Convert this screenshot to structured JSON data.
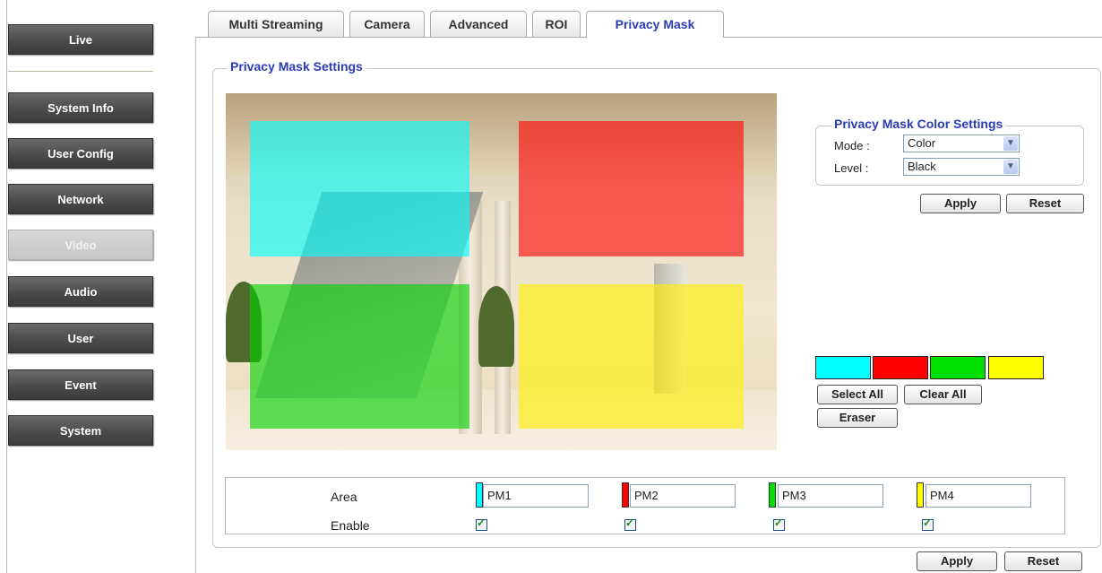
{
  "sidebar": {
    "items": [
      {
        "label": "Live"
      },
      {
        "label": "System Info"
      },
      {
        "label": "User Config"
      },
      {
        "label": "Network"
      },
      {
        "label": "Video",
        "active": true
      },
      {
        "label": "Audio"
      },
      {
        "label": "User"
      },
      {
        "label": "Event"
      },
      {
        "label": "System"
      }
    ]
  },
  "tabs": [
    {
      "label": "Multi Streaming"
    },
    {
      "label": "Camera"
    },
    {
      "label": "Advanced"
    },
    {
      "label": "ROI"
    },
    {
      "label": "Privacy Mask",
      "active": true
    }
  ],
  "settings": {
    "title": "Privacy Mask Settings",
    "color_settings": {
      "title": "Privacy Mask Color Settings",
      "mode_label": "Mode :",
      "mode_value": "Color",
      "level_label": "Level :",
      "level_value": "Black",
      "apply_label": "Apply",
      "reset_label": "Reset"
    },
    "swatches": [
      "#00ffff",
      "#ff0000",
      "#00e000",
      "#ffff00"
    ],
    "select_all_label": "Select All",
    "clear_all_label": "Clear All",
    "eraser_label": "Eraser",
    "area_label": "Area",
    "enable_label": "Enable",
    "areas": [
      {
        "name": "PM1",
        "color": "#00ffff",
        "enabled": true
      },
      {
        "name": "PM2",
        "color": "#ff0000",
        "enabled": true
      },
      {
        "name": "PM3",
        "color": "#00e000",
        "enabled": true
      },
      {
        "name": "PM4",
        "color": "#ffff00",
        "enabled": true
      }
    ],
    "apply_label": "Apply",
    "reset_label": "Reset"
  }
}
